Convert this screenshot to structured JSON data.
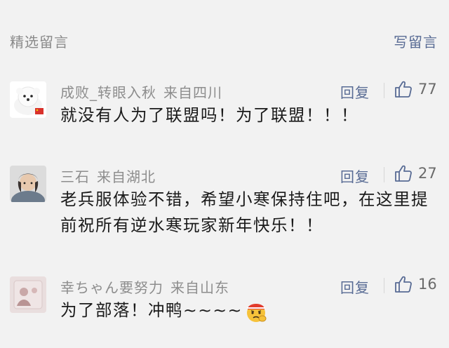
{
  "header": {
    "title": "精选留言",
    "write_label": "写留言"
  },
  "comments": [
    {
      "name": "成败_转眼入秋",
      "location": "来自四川",
      "reply_label": "回复",
      "likes": "77",
      "text": "就没有人为了联盟吗！为了联盟！！！"
    },
    {
      "name": "三石",
      "location": "来自湖北",
      "reply_label": "回复",
      "likes": "27",
      "text": "老兵服体验不错，希望小寒保持住吧，在这里提前祝所有逆水寒玩家新年快乐！！"
    },
    {
      "name": "幸ちゃん要努力",
      "location": "来自山东",
      "reply_label": "回复",
      "likes": "16",
      "text": "为了部落！冲鸭~~~~"
    }
  ],
  "colors": {
    "background": "#f2f2f2",
    "link": "#586b94",
    "meta_text": "#8d8d8d",
    "body_text": "#1a1a1a"
  },
  "icons": [
    "thumbs-up-icon",
    "pompom-emoji"
  ]
}
